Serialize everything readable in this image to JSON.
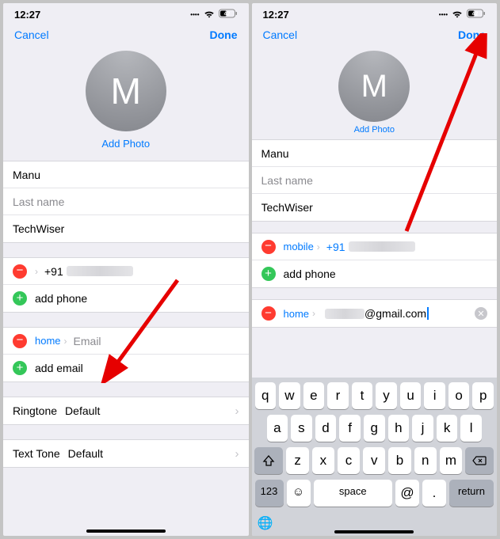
{
  "status": {
    "time": "12:27",
    "battery": "42"
  },
  "nav": {
    "cancel": "Cancel",
    "done": "Done"
  },
  "avatar": {
    "letter": "M",
    "add_photo": "Add Photo"
  },
  "contact": {
    "first_name": "Manu",
    "last_name_placeholder": "Last name",
    "company": "TechWiser"
  },
  "phones": {
    "existing": {
      "label": "mobile",
      "prefix": "+91"
    },
    "add_label": "add phone",
    "prefix_no_label": "+91"
  },
  "emails": {
    "field_label": "home",
    "placeholder": "Email",
    "value_suffix": "@gmail.com",
    "add_label": "add email"
  },
  "meta": {
    "ringtone_label": "Ringtone",
    "ringtone_value": "Default",
    "text_tone_label": "Text Tone",
    "text_tone_value": "Default"
  },
  "keyboard": {
    "rows": [
      [
        "q",
        "w",
        "e",
        "r",
        "t",
        "y",
        "u",
        "i",
        "o",
        "p"
      ],
      [
        "a",
        "s",
        "d",
        "f",
        "g",
        "h",
        "j",
        "k",
        "l"
      ],
      [
        "z",
        "x",
        "c",
        "v",
        "b",
        "n",
        "m"
      ]
    ],
    "num": "123",
    "space": "space",
    "at": "@",
    "dot": ".",
    "ret": "return"
  }
}
